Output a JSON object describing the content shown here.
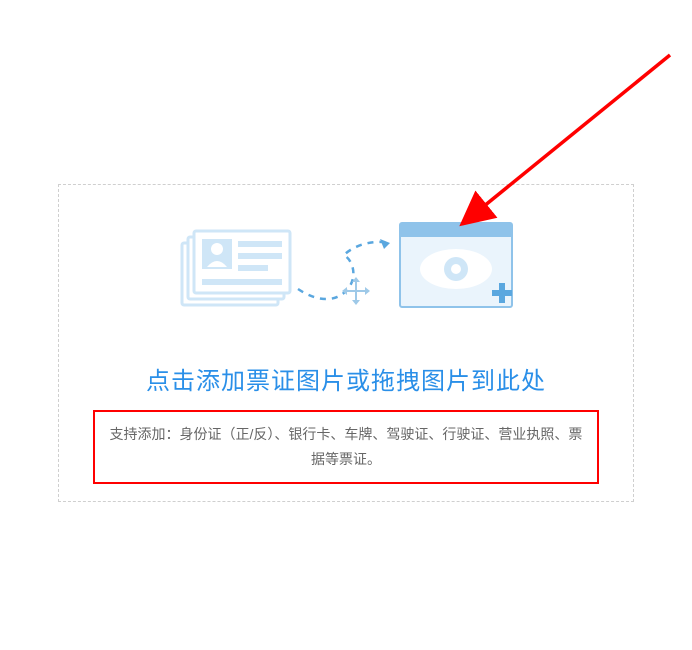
{
  "upload": {
    "prompt": "点击添加票证图片或拖拽图片到此处",
    "supported_text": "支持添加：身份证（正/反）、银行卡、车牌、驾驶证、行驶证、营业执照、票据等票证。"
  },
  "icons": {
    "source": "id-card-stack-icon",
    "target": "preview-eye-icon",
    "add": "plus-icon",
    "move": "move-cursor-icon",
    "flow": "dashed-arrow-icon"
  },
  "annotation": {
    "arrow_target": "preview-eye-icon"
  },
  "colors": {
    "accent": "#2a8fe8",
    "highlight_border": "#ff0000",
    "arrow": "#ff0000",
    "icon_light": "#cfe6f7",
    "icon_line": "#5aa7df"
  }
}
